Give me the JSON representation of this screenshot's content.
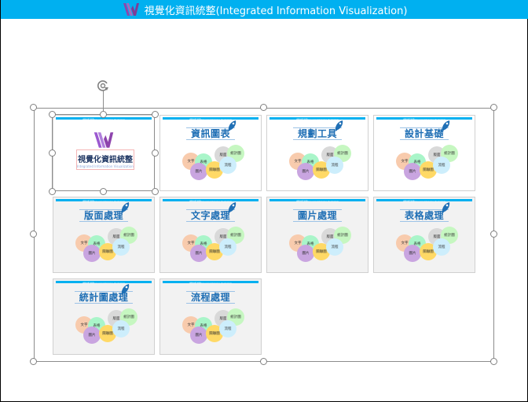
{
  "window": {
    "title": "視覺化資訊統整(Integrated Information Visualization)",
    "title_bg": "#00b0f0"
  },
  "slides": [
    {
      "title": "視覺化資訊統整",
      "subtitle": "Integrated Information Visualization",
      "type": "cover",
      "selected": true
    },
    {
      "title": "資訊圖表",
      "type": "content",
      "rocket": true
    },
    {
      "title": "規劃工具",
      "type": "content",
      "rocket": true
    },
    {
      "title": "設計基礎",
      "type": "content",
      "rocket": true
    },
    {
      "title": "版面處理",
      "type": "content",
      "rocket": true
    },
    {
      "title": "文字處理",
      "type": "content",
      "rocket": true
    },
    {
      "title": "圖片處理",
      "type": "content",
      "rocket": false
    },
    {
      "title": "表格處理",
      "type": "content",
      "rocket": true
    },
    {
      "title": "統計圖處理",
      "type": "content",
      "rocket": true
    },
    {
      "title": "流程處理",
      "type": "content",
      "rocket": false
    }
  ],
  "slide_header_text": "視覺化資訊統整(Integrated Information Visualization)",
  "bubbles": [
    {
      "label": "文字",
      "color": "#f8cbad"
    },
    {
      "label": "表格",
      "color": "#a9f5c9"
    },
    {
      "label": "版面",
      "color": "#d9d9d9"
    },
    {
      "label": "統計圖",
      "color": "#c6f7c1"
    },
    {
      "label": "圖片",
      "color": "#c9a5e0"
    },
    {
      "label": "關聯圖",
      "color": "#ffd966"
    },
    {
      "label": "流程",
      "color": "#cdeefc"
    }
  ],
  "colors": {
    "accent": "#00b0f0",
    "title_text": "#1f6fb5",
    "logo_purple": "#9b59d0"
  }
}
